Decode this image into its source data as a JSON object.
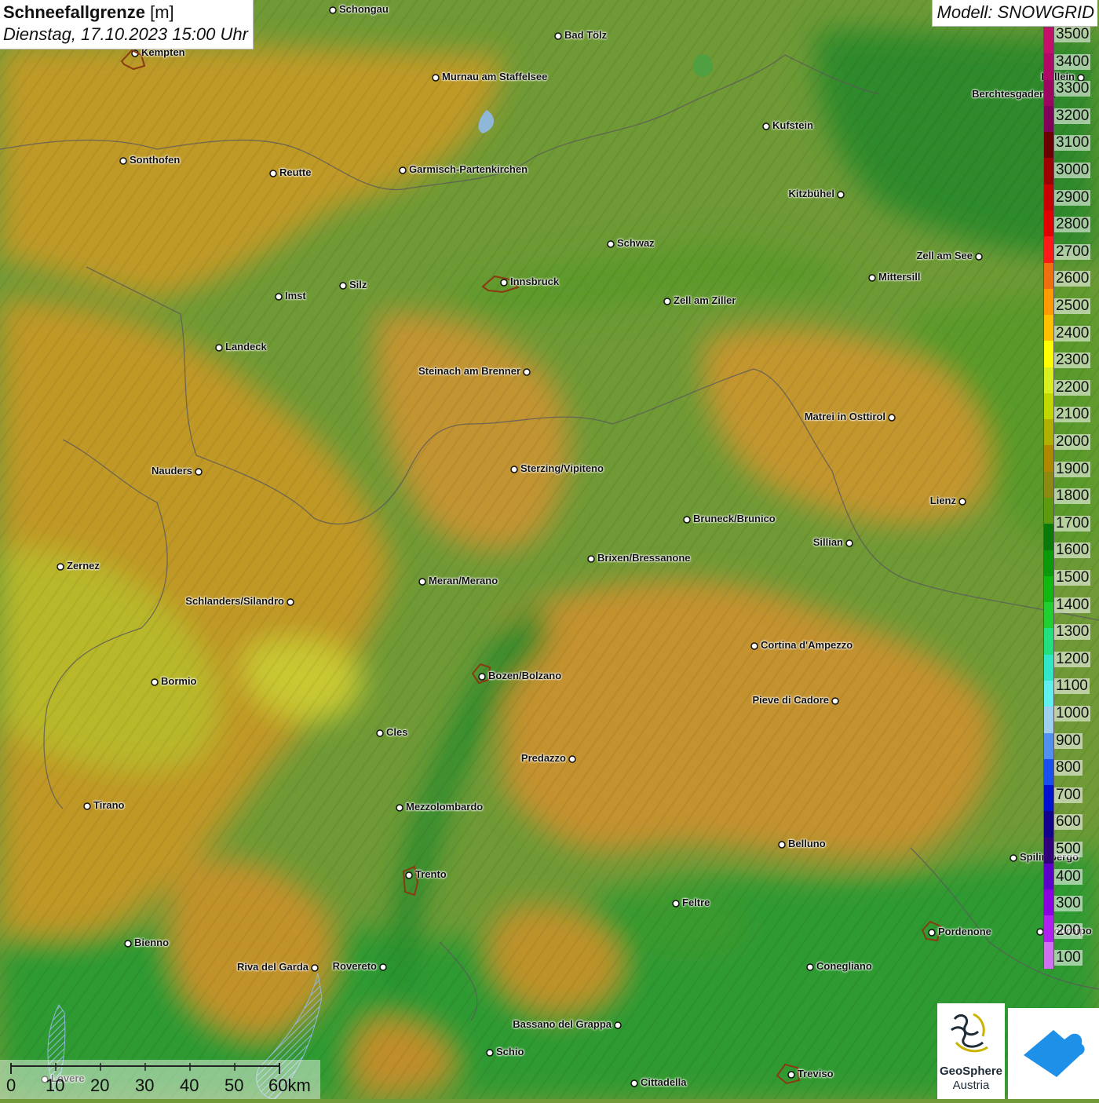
{
  "title": {
    "main": "Schneefallgrenze",
    "unit": "[m]",
    "date": "Dienstag, 17.10.2023 15:00 Uhr"
  },
  "model": "Modell: SNOWGRID",
  "legend": {
    "levels": [
      "3500",
      "3400",
      "3300",
      "3200",
      "3100",
      "3000",
      "2900",
      "2800",
      "2700",
      "2600",
      "2500",
      "2400",
      "2300",
      "2200",
      "2100",
      "2000",
      "1900",
      "1800",
      "1700",
      "1600",
      "1500",
      "1400",
      "1300",
      "1200",
      "1100",
      "1000",
      "900",
      "800",
      "700",
      "600",
      "500",
      "400",
      "300",
      "200",
      "100"
    ],
    "colors": [
      "#c4106a",
      "#b00a66",
      "#9a0660",
      "#80005a",
      "#6a0000",
      "#9c0000",
      "#c80000",
      "#e00000",
      "#ff1a1a",
      "#f07010",
      "#ff9a00",
      "#ffc000",
      "#ffff00",
      "#d8f020",
      "#c0d800",
      "#b0b000",
      "#b08800",
      "#8c8a10",
      "#5e9a10",
      "#0a7a0a",
      "#0a9a0a",
      "#10b810",
      "#20d030",
      "#20e080",
      "#30e8c8",
      "#60f0f0",
      "#a0d0f0",
      "#5090f0",
      "#1850f0",
      "#0010d0",
      "#10008c",
      "#30007c",
      "#5a00c8",
      "#8a00e0",
      "#b020f0",
      "#d070f0"
    ]
  },
  "cities": [
    {
      "name": "Schongau",
      "marker": "circle"
    },
    {
      "name": "Bad Tölz",
      "marker": "circle"
    },
    {
      "name": "Kempten",
      "marker": "outline"
    },
    {
      "name": "Murnau am Staffelsee",
      "marker": "circle"
    },
    {
      "name": "Hallein",
      "marker": "circle"
    },
    {
      "name": "Berchtesgaden",
      "marker": "circle"
    },
    {
      "name": "Kufstein",
      "marker": "circle"
    },
    {
      "name": "Sonthofen",
      "marker": "circle"
    },
    {
      "name": "Reutte",
      "marker": "circle"
    },
    {
      "name": "Garmisch-Partenkirchen",
      "marker": "circle"
    },
    {
      "name": "Kitzbühel",
      "marker": "circle"
    },
    {
      "name": "Schwaz",
      "marker": "circle"
    },
    {
      "name": "Zell am See",
      "marker": "circle"
    },
    {
      "name": "Imst",
      "marker": "circle"
    },
    {
      "name": "Silz",
      "marker": "circle"
    },
    {
      "name": "Innsbruck",
      "marker": "outline"
    },
    {
      "name": "Mittersill",
      "marker": "circle"
    },
    {
      "name": "Zell am Ziller",
      "marker": "circle"
    },
    {
      "name": "Landeck",
      "marker": "circle"
    },
    {
      "name": "Steinach am Brenner",
      "marker": "circle"
    },
    {
      "name": "Matrei in Osttirol",
      "marker": "circle"
    },
    {
      "name": "Nauders",
      "marker": "circle"
    },
    {
      "name": "Sterzing/Vipiteno",
      "marker": "circle"
    },
    {
      "name": "Lienz",
      "marker": "circle"
    },
    {
      "name": "Bruneck/Brunico",
      "marker": "circle"
    },
    {
      "name": "Sillian",
      "marker": "circle"
    },
    {
      "name": "Brixen/Bressanone",
      "marker": "circle"
    },
    {
      "name": "Zernez",
      "marker": "circle"
    },
    {
      "name": "Meran/Merano",
      "marker": "circle"
    },
    {
      "name": "Schlanders/Silandro",
      "marker": "circle"
    },
    {
      "name": "Cortina d'Ampezzo",
      "marker": "circle"
    },
    {
      "name": "Bozen/Bolzano",
      "marker": "outline"
    },
    {
      "name": "Bormio",
      "marker": "circle"
    },
    {
      "name": "Pieve di Cadore",
      "marker": "circle"
    },
    {
      "name": "Cles",
      "marker": "circle"
    },
    {
      "name": "Predazzo",
      "marker": "circle"
    },
    {
      "name": "Tirano",
      "marker": "circle"
    },
    {
      "name": "Mezzolombardo",
      "marker": "circle"
    },
    {
      "name": "Belluno",
      "marker": "circle"
    },
    {
      "name": "Spilimbergo",
      "marker": "circle"
    },
    {
      "name": "Trento",
      "marker": "outline"
    },
    {
      "name": "Feltre",
      "marker": "circle"
    },
    {
      "name": "Pordenone",
      "marker": "outline"
    },
    {
      "name": "Codroipo",
      "marker": "circle"
    },
    {
      "name": "Bienno",
      "marker": "circle"
    },
    {
      "name": "Riva del Garda",
      "marker": "circle"
    },
    {
      "name": "Rovereto",
      "marker": "circle"
    },
    {
      "name": "Conegliano",
      "marker": "circle"
    },
    {
      "name": "Bassano del Grappa",
      "marker": "circle"
    },
    {
      "name": "Schio",
      "marker": "circle"
    },
    {
      "name": "Lovere",
      "marker": "circle"
    },
    {
      "name": "Treviso",
      "marker": "outline"
    },
    {
      "name": "Cittadella",
      "marker": "circle"
    }
  ],
  "scale": {
    "ticks": [
      "0",
      "10",
      "20",
      "30",
      "40",
      "50",
      "60km"
    ]
  },
  "logos": {
    "geosphere_line1": "GeoSphere",
    "geosphere_line2": "Austria",
    "app_icon": "cloud-snow-app-icon"
  }
}
